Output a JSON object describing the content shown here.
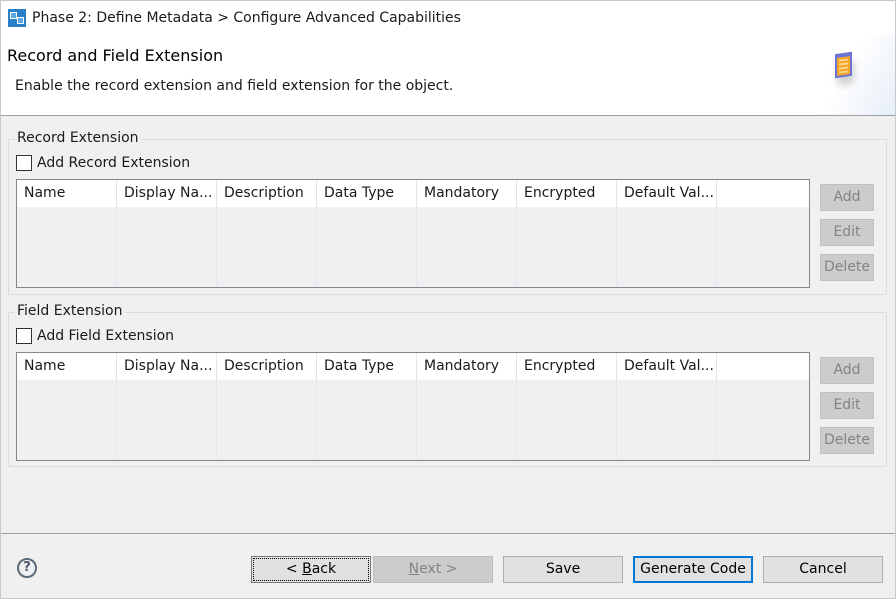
{
  "window": {
    "title": "Phase 2: Define Metadata > Configure Advanced Capabilities",
    "icon": "wizard-icon"
  },
  "header": {
    "title": "Record and Field Extension",
    "description": "Enable the record extension and field extension for the object.",
    "icon": "table-document-icon"
  },
  "columns": [
    "Name",
    "Display Na...",
    "Description",
    "Data Type",
    "Mandatory",
    "Encrypted",
    "Default Val..."
  ],
  "record_extension": {
    "group_label": "Record Extension",
    "checkbox_label": "Add Record Extension",
    "checked": false,
    "rows": [],
    "buttons": {
      "add": "Add",
      "edit": "Edit",
      "delete": "Delete"
    }
  },
  "field_extension": {
    "group_label": "Field Extension",
    "checkbox_label": "Add Field Extension",
    "checked": false,
    "rows": [],
    "buttons": {
      "add": "Add",
      "edit": "Edit",
      "delete": "Delete"
    }
  },
  "footer": {
    "help_icon": "?",
    "back_prefix": "< ",
    "back_mnemonic": "B",
    "back_rest": "ack",
    "next_mnemonic": "N",
    "next_rest": "ext >",
    "save": "Save",
    "generate": "Generate Code",
    "cancel": "Cancel"
  },
  "colors": {
    "focus_border": "#0078d7",
    "disabled_button": "#cccccc",
    "disabled_text": "#838383"
  }
}
